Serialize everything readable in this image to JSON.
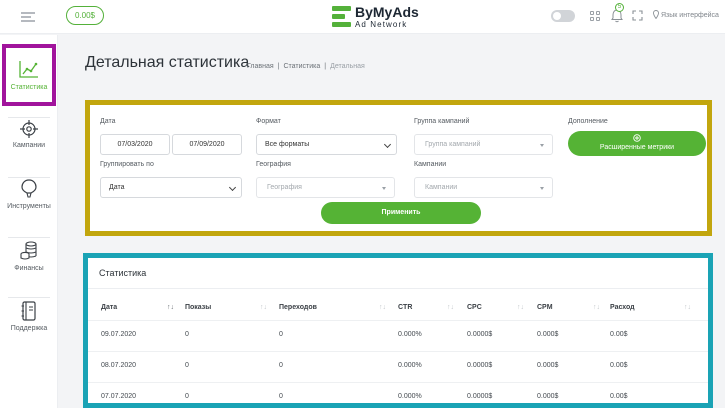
{
  "header": {
    "balance": "0.00$",
    "logo_name": "ByMyAds",
    "logo_sub": "Ad Network",
    "notifications_count": "5",
    "language_label": "Язык интерфейса"
  },
  "sidebar": {
    "items": [
      {
        "label": "Статистика",
        "icon": "chart-icon",
        "active": true
      },
      {
        "label": "Кампании",
        "icon": "target-icon"
      },
      {
        "label": "Инструменты",
        "icon": "balloon-icon"
      },
      {
        "label": "Финансы",
        "icon": "coins-icon"
      },
      {
        "label": "Поддержка",
        "icon": "notebook-icon"
      }
    ]
  },
  "page": {
    "title": "Детальная статистика",
    "breadcrumbs": [
      "Главная",
      "|",
      "Статистика",
      "|",
      "Детальная"
    ]
  },
  "filters": {
    "date_label": "Дата",
    "date_from": "07/03/2020",
    "date_to": "07/09/2020",
    "format_label": "Формат",
    "format_value": "Все форматы",
    "group_label": "Группа кампаний",
    "group_placeholder": "Группа кампаний",
    "extra_label": "Дополнение",
    "extended_metrics": "Расширенные метрики",
    "group_by_label": "Группировать по",
    "group_by_value": "Дата",
    "geo_label": "География",
    "geo_placeholder": "География",
    "campaigns_label": "Кампании",
    "campaigns_placeholder": "Кампании",
    "apply": "Применить"
  },
  "stats": {
    "title": "Статистика",
    "columns": [
      "Дата",
      "Показы",
      "Переходов",
      "CTR",
      "CPC",
      "CPM",
      "Расход"
    ],
    "rows": [
      [
        "09.07.2020",
        "0",
        "0",
        "0.000%",
        "0.0000$",
        "0.000$",
        "0.00$"
      ],
      [
        "08.07.2020",
        "0",
        "0",
        "0.000%",
        "0.0000$",
        "0.000$",
        "0.00$"
      ],
      [
        "07.07.2020",
        "0",
        "0",
        "0.000%",
        "0.0000$",
        "0.000$",
        "0.00$"
      ]
    ]
  },
  "colors": {
    "accent": "#55b335",
    "sidebar_highlight": "#a1149c",
    "filter_highlight": "#c2a60e",
    "stats_highlight": "#1aa3b5"
  }
}
